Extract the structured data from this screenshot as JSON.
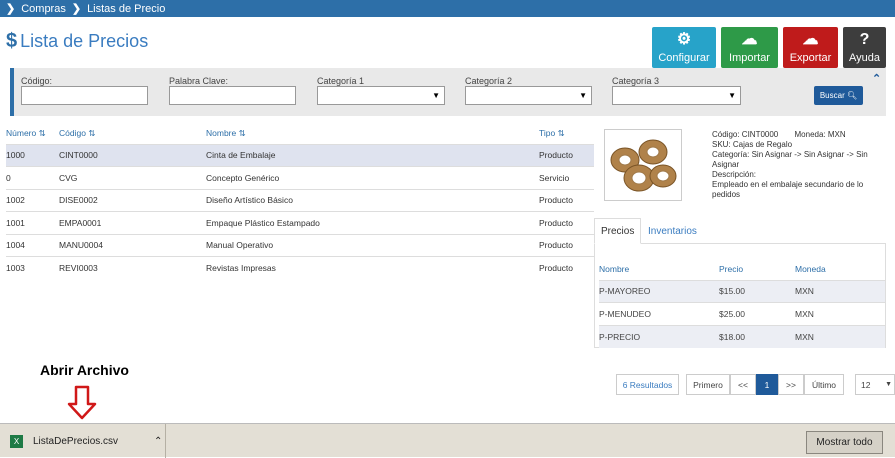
{
  "breadcrumb": {
    "item1": "Compras",
    "item2": "Listas de Precio"
  },
  "page": {
    "title": "Lista de Precios"
  },
  "actions": {
    "configurar": "Configurar",
    "importar": "Importar",
    "exportar": "Exportar",
    "ayuda": "Ayuda"
  },
  "colors": {
    "configurar": "#27a3c9",
    "importar": "#2e9a48",
    "exportar": "#bf1b1b",
    "ayuda": "#3d3d3d",
    "header": "#2d6fa8"
  },
  "filters": {
    "codigo_label": "Código:",
    "palabra_label": "Palabra Clave:",
    "cat1_label": "Categoría 1",
    "cat2_label": "Categoría 2",
    "cat3_label": "Categoría 3",
    "buscar_label": "Buscar"
  },
  "table": {
    "headers": {
      "numero": "Número",
      "codigo": "Código",
      "nombre": "Nombre",
      "tipo": "Tipo"
    },
    "rows": [
      {
        "numero": "1000",
        "codigo": "CINT0000",
        "nombre": "Cinta de Embalaje",
        "tipo": "Producto"
      },
      {
        "numero": "0",
        "codigo": "CVG",
        "nombre": "Concepto Genérico",
        "tipo": "Servicio"
      },
      {
        "numero": "1002",
        "codigo": "DISE0002",
        "nombre": "Diseño Artístico Básico",
        "tipo": "Producto"
      },
      {
        "numero": "1001",
        "codigo": "EMPA0001",
        "nombre": "Empaque Plástico Estampado",
        "tipo": "Producto"
      },
      {
        "numero": "1004",
        "codigo": "MANU0004",
        "nombre": "Manual Operativo",
        "tipo": "Producto"
      },
      {
        "numero": "1003",
        "codigo": "REVI0003",
        "nombre": "Revistas Impresas",
        "tipo": "Producto"
      }
    ]
  },
  "detail": {
    "codigo": "Código: CINT0000",
    "moneda": "Moneda: MXN",
    "sku": "SKU: Cajas de Regalo",
    "categoria": "Categoría: Sin Asignar -> Sin Asignar -> Sin Asignar",
    "descripcion_label": "Descripción:",
    "descripcion": "Empleado en el embalaje secundario de lo pedidos"
  },
  "tabs": {
    "precios": "Precios",
    "inventarios": "Inventarios"
  },
  "prices": {
    "headers": {
      "nombre": "Nombre",
      "precio": "Precio",
      "moneda": "Moneda"
    },
    "rows": [
      {
        "nombre": "P-MAYOREO",
        "precio": "$15.00",
        "moneda": "MXN"
      },
      {
        "nombre": "P-MENUDEO",
        "precio": "$25.00",
        "moneda": "MXN"
      },
      {
        "nombre": "P-PRECIO",
        "precio": "$18.00",
        "moneda": "MXN"
      }
    ]
  },
  "pagination": {
    "results": "6 Resultados",
    "first": "Primero",
    "prev": "<<",
    "current": "1",
    "next": ">>",
    "last": "Último",
    "page_size": "12"
  },
  "annotation": "Abrir Archivo",
  "download": {
    "filename": "ListaDePrecios.csv",
    "show_all": "Mostrar todo"
  }
}
